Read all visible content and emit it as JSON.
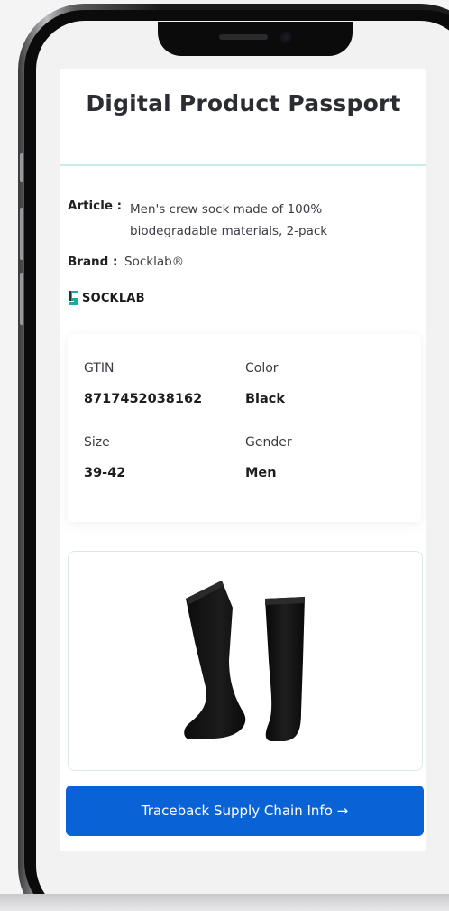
{
  "page": {
    "title": "Digital Product Passport"
  },
  "product": {
    "article_label": "Article :",
    "article_value": "Men's crew sock made of 100% biodegradable materials, 2-pack",
    "brand_label": "Brand :",
    "brand_value": "Socklab®",
    "logo_text": "SOCKLAB"
  },
  "specs": {
    "gtin_label": "GTIN",
    "gtin_value": "8717452038162",
    "color_label": "Color",
    "color_value": "Black",
    "size_label": "Size",
    "size_value": "39-42",
    "gender_label": "Gender",
    "gender_value": "Men"
  },
  "cta": {
    "label": "Traceback Supply Chain Info →"
  },
  "colors": {
    "accent": "#0a63d6",
    "divider": "#c9ebec",
    "logo_teal": "#1fa8a0"
  }
}
